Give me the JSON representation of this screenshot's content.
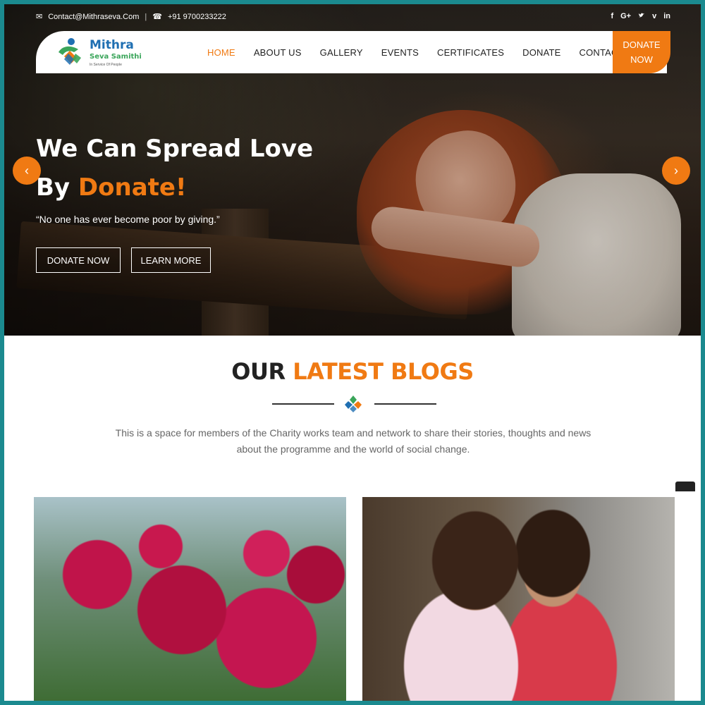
{
  "topbar": {
    "email": "Contact@Mithraseva.Com",
    "phone": "+91 9700233222",
    "social": [
      "f",
      "G+",
      "t",
      "v",
      "in"
    ]
  },
  "logo": {
    "name": "Mithra",
    "subtitle": "Seva Samithi",
    "tagline": "In Service Of People"
  },
  "nav": {
    "items": [
      {
        "label": "HOME",
        "active": true
      },
      {
        "label": "ABOUT US"
      },
      {
        "label": "GALLERY"
      },
      {
        "label": "EVENTS"
      },
      {
        "label": "CERTIFICATES"
      },
      {
        "label": "DONATE"
      },
      {
        "label": "CONTACT"
      }
    ],
    "donate_line1": "DONATE",
    "donate_line2": "NOW"
  },
  "hero": {
    "title_line1": "We Can Spread Love",
    "title_line2_prefix": "By ",
    "title_line2_accent": "Donate!",
    "quote": "“No one has ever become poor by giving.”",
    "btn_donate": "DONATE NOW",
    "btn_learn": "LEARN MORE",
    "arrow_left": "‹",
    "arrow_right": "›"
  },
  "blogs": {
    "title_prefix": "OUR ",
    "title_accent": "LATEST BLOGS",
    "description": "This is a space for members of the Charity works team and network to share their stories, thoughts and news about the programme and the world of social change."
  },
  "colors": {
    "accent": "#f07a13",
    "frame": "#1b8a8f",
    "logo_blue": "#1f6fb2",
    "logo_green": "#3aa55a"
  }
}
